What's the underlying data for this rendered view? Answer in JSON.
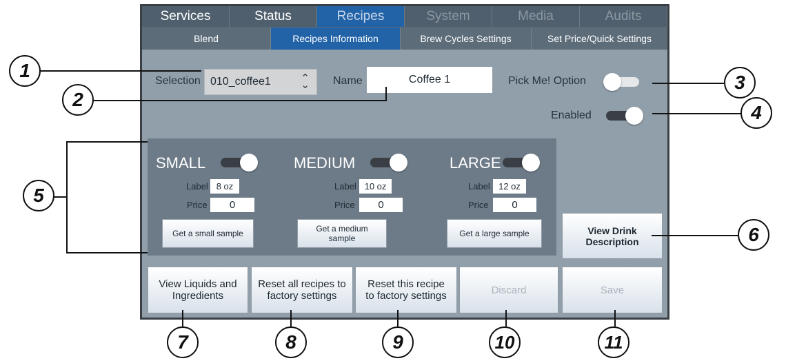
{
  "tabs": [
    {
      "label": "Services",
      "state": "normal"
    },
    {
      "label": "Status",
      "state": "normal"
    },
    {
      "label": "Recipes",
      "state": "active"
    },
    {
      "label": "System",
      "state": "disabled"
    },
    {
      "label": "Media",
      "state": "disabled"
    },
    {
      "label": "Audits",
      "state": "disabled"
    }
  ],
  "subtabs": [
    {
      "label": "Blend",
      "state": "normal"
    },
    {
      "label": "Recipes Information",
      "state": "active"
    },
    {
      "label": "Brew Cycles Settings",
      "state": "normal"
    },
    {
      "label": "Set Price/Quick Settings",
      "state": "normal"
    }
  ],
  "form": {
    "selection_label": "Selection",
    "selection_value": "010_coffee1",
    "name_label": "Name",
    "name_value": "Coffee 1",
    "pick_me_label": "Pick Me! Option",
    "pick_me_on": false,
    "enabled_label": "Enabled",
    "enabled_on": true
  },
  "sizes": [
    {
      "name": "SMALL",
      "on": true,
      "label_caption": "Label",
      "label_value": "8 oz",
      "price_caption": "Price",
      "price_value": "0",
      "sample_button": "Get a small sample"
    },
    {
      "name": "MEDIUM",
      "on": true,
      "label_caption": "Label",
      "label_value": "10 oz",
      "price_caption": "Price",
      "price_value": "0",
      "sample_button": "Get a medium sample"
    },
    {
      "name": "LARGE",
      "on": true,
      "label_caption": "Label",
      "label_value": "12 oz",
      "price_caption": "Price",
      "price_value": "0",
      "sample_button": "Get a large sample"
    }
  ],
  "buttons": {
    "view_drink_description": "View Drink Description",
    "view_liquids": "View Liquids and Ingredients",
    "reset_all": "Reset all recipes to factory settings",
    "reset_this": "Reset this recipe to factory settings",
    "discard": "Discard",
    "save": "Save"
  },
  "callouts": [
    "1",
    "2",
    "3",
    "4",
    "5",
    "6",
    "7",
    "8",
    "9",
    "10",
    "11"
  ],
  "colors": {
    "active_tab": "#2263a8",
    "panel": "#919fab",
    "size_panel": "#6d7b88"
  }
}
